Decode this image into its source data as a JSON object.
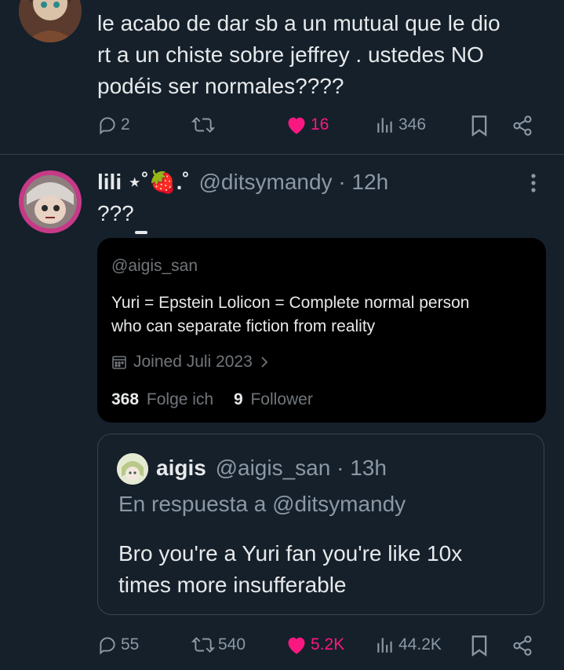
{
  "tweet1": {
    "text_line1": "le acabo de dar sb a un mutual que le dio",
    "text_line2": "rt a un chiste sobre jeffrey . ustedes NO",
    "text_line3": "podéis ser normales????",
    "actions": {
      "replies": "2",
      "retweets": "",
      "likes": "16",
      "views": "346"
    }
  },
  "tweet2": {
    "display_name": "lili ⋆˚🍓.˚",
    "handle": "@ditsymandy",
    "time": "· 12h",
    "text": "???",
    "profile_card": {
      "handle": "@aigis_san",
      "bio_line1": "Yuri = Epstein  Lolicon = Complete normal person",
      "bio_line2": "who can separate fiction from reality",
      "joined": "Joined Juli 2023",
      "following_count": "368",
      "following_label": "Folge ich",
      "followers_count": "9",
      "followers_label": "Follower"
    },
    "quote": {
      "display_name": "aigis",
      "handle": "@aigis_san",
      "time": "· 13h",
      "reply_to": "En respuesta a @ditsymandy",
      "text_line1": "Bro you're a Yuri fan you're like 10x",
      "text_line2": "times more insufferable"
    },
    "actions": {
      "replies": "55",
      "retweets": "540",
      "likes": "5.2K",
      "views": "44.2K"
    }
  },
  "colors": {
    "background": "#15202b",
    "text": "#e7e9ea",
    "muted": "#8b98a5",
    "like": "#f91880",
    "divider": "#38444d",
    "card_bg": "#000000"
  }
}
